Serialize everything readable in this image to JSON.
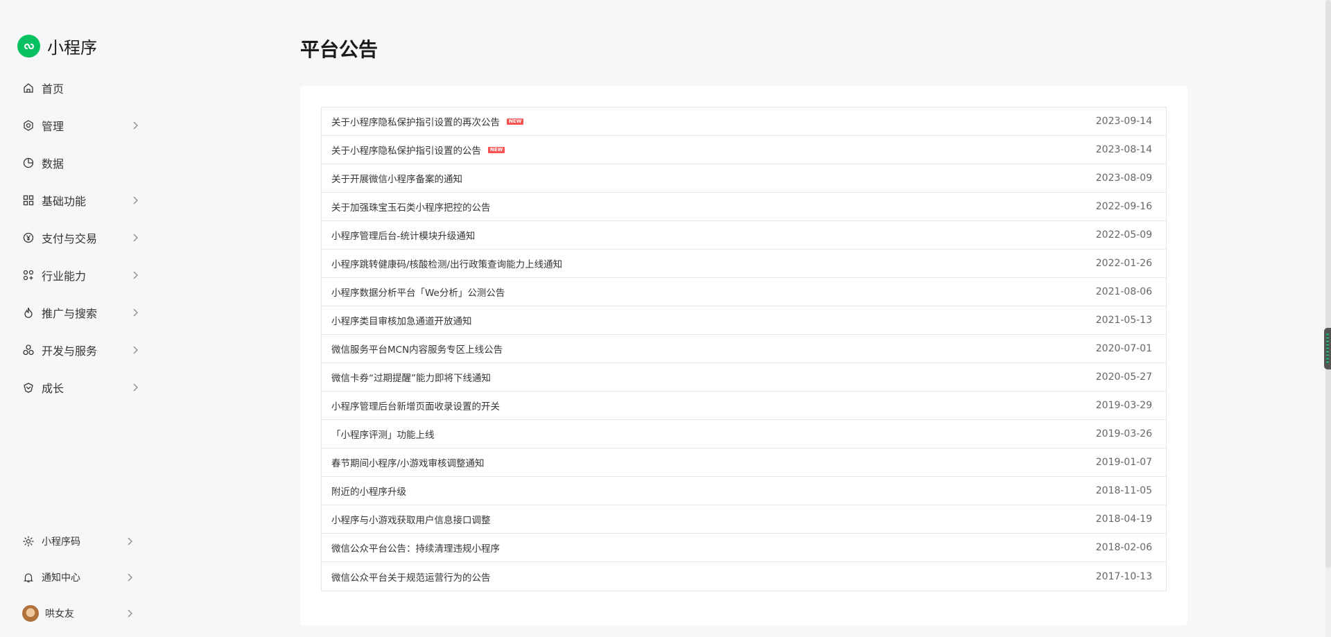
{
  "brand": {
    "name": "小程序",
    "accent": "#07c160"
  },
  "nav": [
    {
      "label": "首页",
      "icon": "home-icon",
      "has_children": false
    },
    {
      "label": "管理",
      "icon": "settings-icon",
      "has_children": true
    },
    {
      "label": "数据",
      "icon": "pie-chart-icon",
      "has_children": false
    },
    {
      "label": "基础功能",
      "icon": "grid-icon",
      "has_children": true
    },
    {
      "label": "支付与交易",
      "icon": "yuan-icon",
      "has_children": true
    },
    {
      "label": "行业能力",
      "icon": "industry-icon",
      "has_children": true
    },
    {
      "label": "推广与搜索",
      "icon": "flame-icon",
      "has_children": true
    },
    {
      "label": "开发与服务",
      "icon": "cluster-icon",
      "has_children": true
    },
    {
      "label": "成长",
      "icon": "growth-icon",
      "has_children": true
    }
  ],
  "bottom_nav": [
    {
      "label": "小程序码",
      "icon": "qrcode-sun-icon"
    },
    {
      "label": "通知中心",
      "icon": "bell-icon"
    },
    {
      "label": "哄女友",
      "icon": "avatar"
    }
  ],
  "page": {
    "title": "平台公告"
  },
  "new_badge_text": "NEW",
  "announcements": [
    {
      "title": "关于小程序隐私保护指引设置的再次公告",
      "date": "2023-09-14",
      "is_new": true
    },
    {
      "title": "关于小程序隐私保护指引设置的公告",
      "date": "2023-08-14",
      "is_new": true
    },
    {
      "title": "关于开展微信小程序备案的通知",
      "date": "2023-08-09",
      "is_new": false
    },
    {
      "title": "关于加强珠宝玉石类小程序把控的公告",
      "date": "2022-09-16",
      "is_new": false
    },
    {
      "title": "小程序管理后台-统计模块升级通知",
      "date": "2022-05-09",
      "is_new": false
    },
    {
      "title": "小程序跳转健康码/核酸检测/出行政策查询能力上线通知",
      "date": "2022-01-26",
      "is_new": false
    },
    {
      "title": "小程序数据分析平台「We分析」公测公告",
      "date": "2021-08-06",
      "is_new": false
    },
    {
      "title": "小程序类目审核加急通道开放通知",
      "date": "2021-05-13",
      "is_new": false
    },
    {
      "title": "微信服务平台MCN内容服务专区上线公告",
      "date": "2020-07-01",
      "is_new": false
    },
    {
      "title": "微信卡券“过期提醒”能力即将下线通知",
      "date": "2020-05-27",
      "is_new": false
    },
    {
      "title": "小程序管理后台新增页面收录设置的开关",
      "date": "2019-03-29",
      "is_new": false
    },
    {
      "title": "「小程序评测」功能上线",
      "date": "2019-03-26",
      "is_new": false
    },
    {
      "title": "春节期间小程序/小游戏审核调整通知",
      "date": "2019-01-07",
      "is_new": false
    },
    {
      "title": "附近的小程序升级",
      "date": "2018-11-05",
      "is_new": false
    },
    {
      "title": "小程序与小游戏获取用户信息接口调整",
      "date": "2018-04-19",
      "is_new": false
    },
    {
      "title": "微信公众平台公告：持续清理违规小程序",
      "date": "2018-02-06",
      "is_new": false
    },
    {
      "title": "微信公众平台关于规范运营行为的公告",
      "date": "2017-10-13",
      "is_new": false
    }
  ]
}
